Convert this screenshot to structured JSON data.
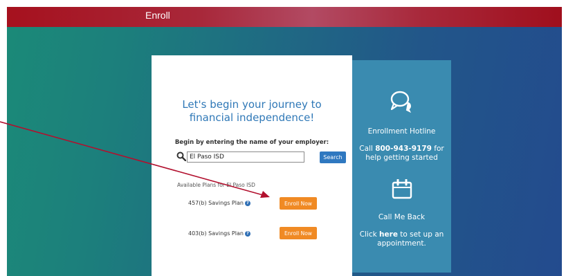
{
  "header": {
    "title": "Enroll"
  },
  "card": {
    "headline_line1": "Let's begin your journey to",
    "headline_line2": "financial independence!",
    "prompt": "Begin by entering the name of your employer:",
    "search": {
      "value": "El Paso ISD",
      "button_label": "Search"
    },
    "plans_label": "Available Plans for El Paso ISD",
    "plans": [
      {
        "name": "457(b) Savings Plan",
        "button_label": "Enroll Now"
      },
      {
        "name": "403(b) Savings Plan",
        "button_label": "Enroll Now"
      }
    ]
  },
  "sidepanel": {
    "hotline": {
      "heading": "Enrollment Hotline",
      "text_prefix": "Call ",
      "phone": "800-943-9179",
      "text_suffix": " for",
      "text_line2": "help getting started"
    },
    "callback": {
      "heading": "Call Me Back",
      "text_prefix": "Click ",
      "link_label": "here",
      "text_suffix": " to set up an",
      "text_line2": "appointment."
    }
  },
  "colors": {
    "topbar": "#a6111e",
    "headline": "#2f78b7",
    "search_button": "#2f78c0",
    "enroll_button": "#f08a24",
    "sidepanel": "#3a8bb0",
    "annotation_arrow": "#b2102e"
  },
  "icons": {
    "search": "magnifier-icon",
    "help": "question-circle-icon",
    "chat": "chat-bubbles-icon",
    "calendar": "calendar-icon",
    "annotation": "arrow-annotation"
  }
}
